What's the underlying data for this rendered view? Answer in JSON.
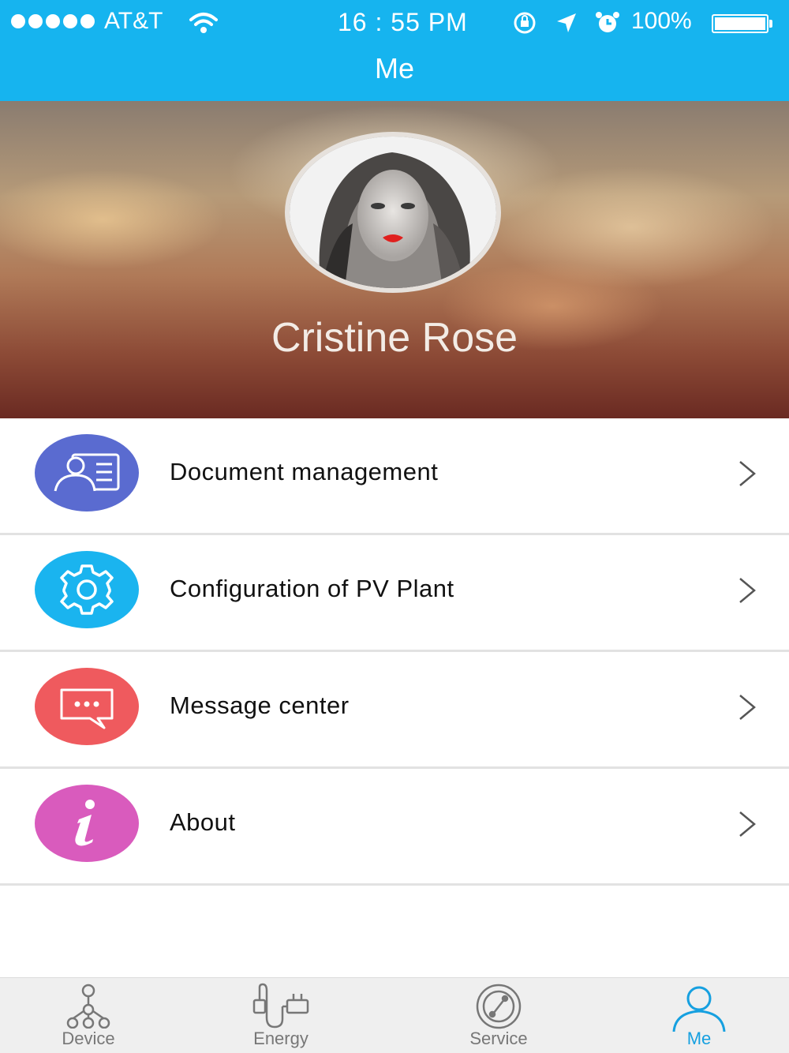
{
  "status_bar": {
    "carrier": "AT&T",
    "time": "16 : 55 PM",
    "battery": "100%"
  },
  "header": {
    "title": "Me"
  },
  "profile": {
    "name": "Cristine Rose"
  },
  "menu": {
    "items": [
      {
        "label": "Document management",
        "icon": "contact-card-icon",
        "color": "#5a6bd0"
      },
      {
        "label": "Configuration of PV Plant",
        "icon": "gear-icon",
        "color": "#1ab4ef"
      },
      {
        "label": "Message center",
        "icon": "chat-bubble-icon",
        "color": "#ef5a5e"
      },
      {
        "label": "About",
        "icon": "info-icon",
        "color": "#d95bbd"
      }
    ]
  },
  "tabbar": {
    "tabs": [
      {
        "label": "Device",
        "icon": "network-tree-icon"
      },
      {
        "label": "Energy",
        "icon": "power-plug-icon"
      },
      {
        "label": "Service",
        "icon": "compass-icon"
      },
      {
        "label": "Me",
        "icon": "person-icon"
      }
    ],
    "active": "Me"
  },
  "colors": {
    "accent": "#16b4ef",
    "tab_active": "#16a0e0"
  }
}
